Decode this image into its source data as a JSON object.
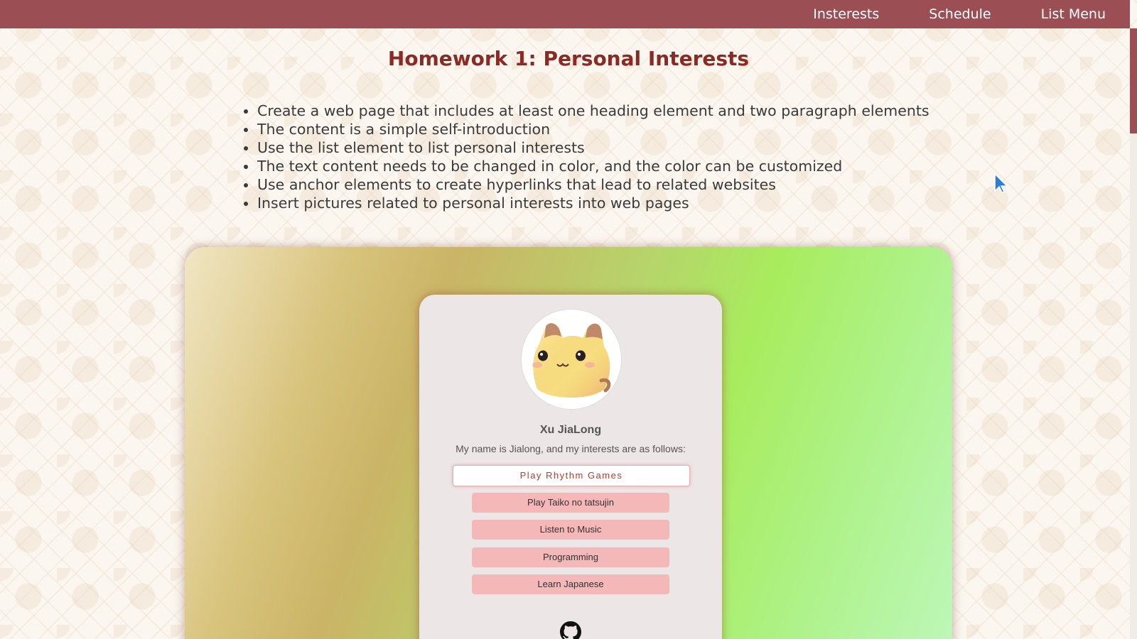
{
  "nav": {
    "items": [
      "Insterests",
      "Schedule",
      "List Menu"
    ]
  },
  "page": {
    "title": "Homework 1: Personal Interests",
    "requirements": [
      "Create a web page that includes at least one heading element and two paragraph elements",
      "The content is a simple self-introduction",
      "Use the list element to list personal interests",
      "The text content needs to be changed in color, and the color can be customized",
      "Use anchor elements to create hyperlinks that lead to related websites",
      "Insert pictures related to personal interests into web pages"
    ]
  },
  "card": {
    "name": "Xu JiaLong",
    "intro": "My name is Jialong, and my interests are as follows:",
    "primary_button": "Play Rhythm Games",
    "buttons": [
      "Play Taiko no tatsujin",
      "Listen to Music",
      "Programming",
      "Learn Japanese"
    ],
    "social_icon": "github-icon"
  },
  "colors": {
    "navbar": "#9b4f55",
    "title": "#8b2a25",
    "button": "#f4b8b8",
    "primary_button_text": "#c0392b"
  }
}
